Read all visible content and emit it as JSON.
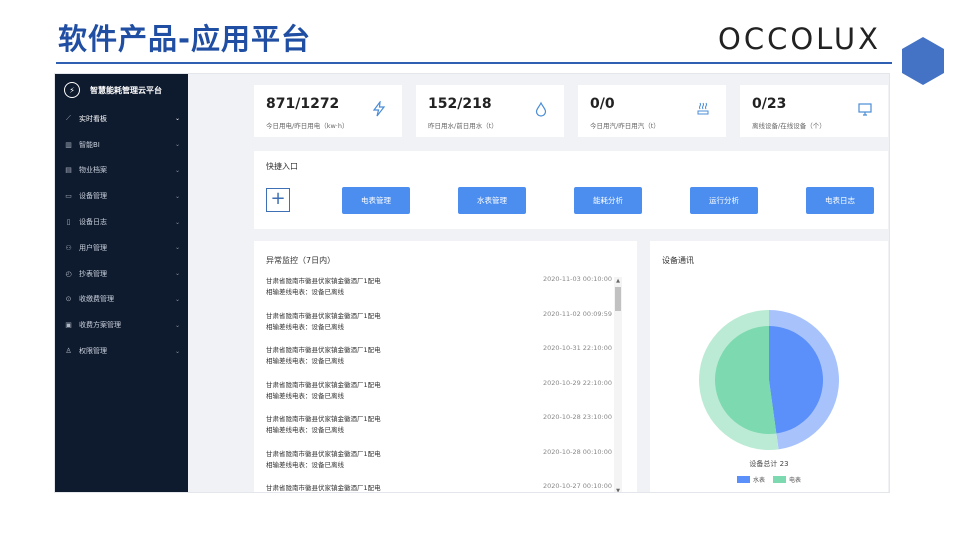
{
  "slide": {
    "title": "软件产品-应用平台",
    "brand": "OCCOLUX"
  },
  "sidebar": {
    "brand_label": "智慧能耗管理云平台",
    "brand_icon": "logo-icon",
    "items": [
      {
        "label": "实时看板",
        "icon": "chart-icon",
        "active": true
      },
      {
        "label": "智能BI",
        "icon": "bar-chart-icon"
      },
      {
        "label": "物业档案",
        "icon": "document-icon"
      },
      {
        "label": "设备管理",
        "icon": "monitor-icon"
      },
      {
        "label": "设备日志",
        "icon": "file-icon"
      },
      {
        "label": "用户管理",
        "icon": "users-icon"
      },
      {
        "label": "抄表管理",
        "icon": "meter-icon"
      },
      {
        "label": "收缴费管理",
        "icon": "payment-icon"
      },
      {
        "label": "收费方案管理",
        "icon": "plan-icon"
      },
      {
        "label": "权限管理",
        "icon": "permission-icon"
      }
    ]
  },
  "stats": [
    {
      "value": "871/1272",
      "label": "今日用电/昨日用电（kw·h）",
      "icon": "lightning-icon"
    },
    {
      "value": "152/218",
      "label": "昨日用水/前日用水（t）",
      "icon": "water-drop-icon"
    },
    {
      "value": "0/0",
      "label": "今日用汽/昨日用汽（t）",
      "icon": "steam-icon"
    },
    {
      "value": "0/23",
      "label": "离线设备/在线设备（个）",
      "icon": "monitor-icon"
    }
  ],
  "quick_access": {
    "title": "快捷入口",
    "buttons": [
      "电表管理",
      "水表管理",
      "能耗分析",
      "运行分析",
      "电表日志"
    ]
  },
  "alerts": {
    "title": "异常监控（7日内）",
    "rows": [
      {
        "location": "甘肃省陇南市徽县伏家镇金徽酒厂1配电",
        "message": "相输差线电表：设备已离线",
        "time": "2020-11-03 00:10:00"
      },
      {
        "location": "甘肃省陇南市徽县伏家镇金徽酒厂1配电",
        "message": "相输差线电表：设备已离线",
        "time": "2020-11-02 00:09:59"
      },
      {
        "location": "甘肃省陇南市徽县伏家镇金徽酒厂1配电",
        "message": "相输差线电表：设备已离线",
        "time": "2020-10-31 22:10:00"
      },
      {
        "location": "甘肃省陇南市徽县伏家镇金徽酒厂1配电",
        "message": "相输差线电表：设备已离线",
        "time": "2020-10-29 22:10:00"
      },
      {
        "location": "甘肃省陇南市徽县伏家镇金徽酒厂1配电",
        "message": "相输差线电表：设备已离线",
        "time": "2020-10-28 23:10:00"
      },
      {
        "location": "甘肃省陇南市徽县伏家镇金徽酒厂1配电",
        "message": "相输差线电表：设备已离线",
        "time": "2020-10-28 00:10:00"
      },
      {
        "location": "甘肃省陇南市徽县伏家镇金徽酒厂1配电",
        "message": "",
        "time": "2020-10-27 00:10:00"
      }
    ]
  },
  "device_comm": {
    "title": "设备通讯",
    "total_label": "设备总计 23",
    "legend": [
      {
        "label": "水表",
        "color": "#5b8ff9"
      },
      {
        "label": "电表",
        "color": "#7dd9b0"
      }
    ]
  },
  "chart_data": {
    "type": "pie",
    "title": "设备通讯",
    "categories": [
      "水表",
      "电表"
    ],
    "values": [
      11,
      12
    ],
    "colors": [
      "#5b8ff9",
      "#7dd9b0"
    ]
  }
}
